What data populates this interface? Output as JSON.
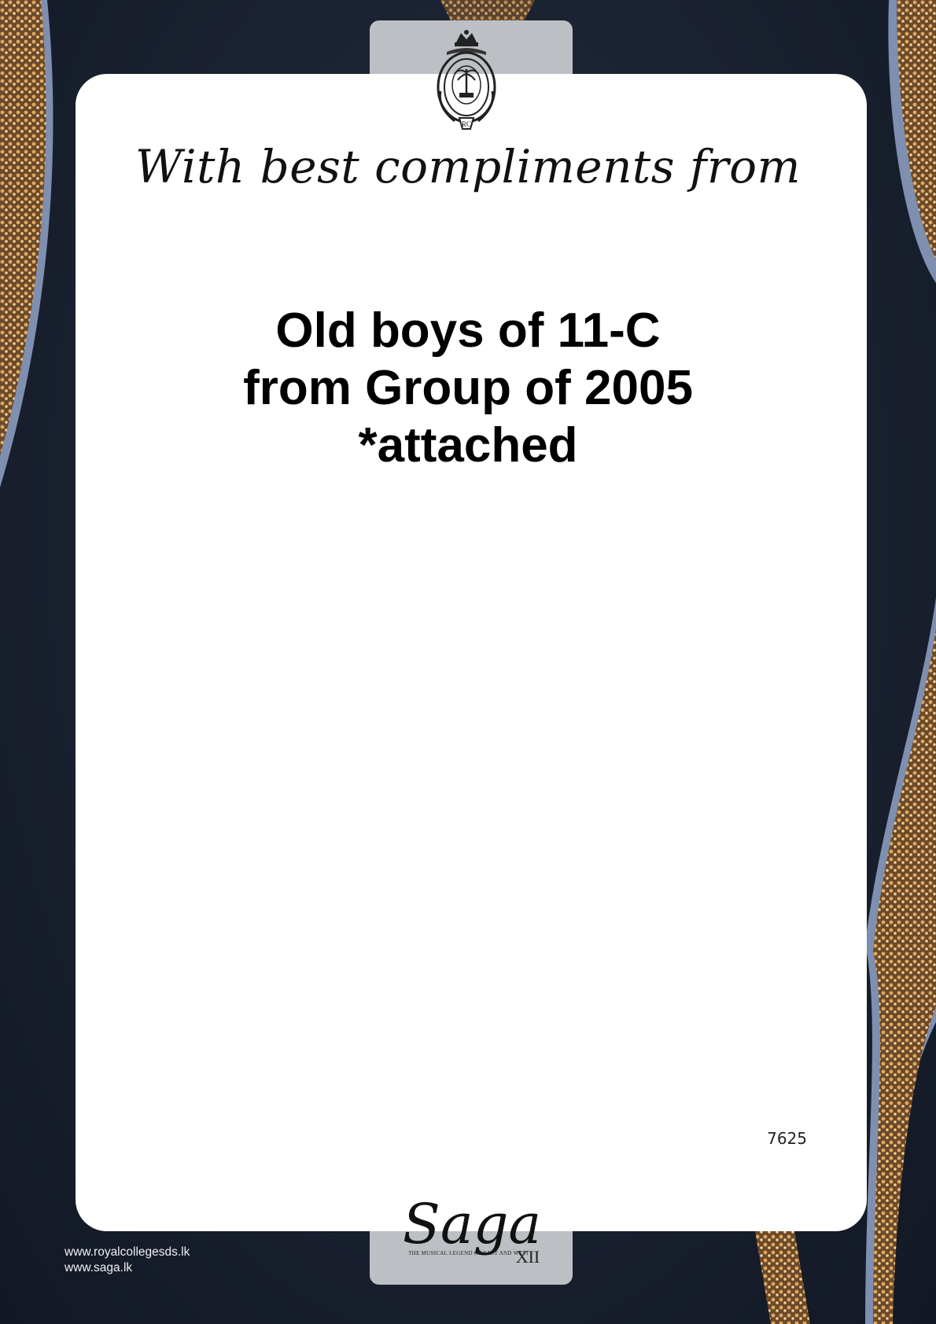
{
  "card": {
    "greeting": "With best compliments from",
    "donor_lines": [
      "Old boys of 11-C",
      "from Group of 2005",
      "*attached"
    ],
    "reference_number": "7625"
  },
  "crest": {
    "motto_top": "FLOREAT",
    "motto_ring": "DISCE AUT DISCEDE",
    "monogram": "RC"
  },
  "sponsor_logo": {
    "name": "Saga",
    "tagline": "THE MUSICAL LEGEND OF EAST AND WEST",
    "edition": "XII"
  },
  "footer": {
    "links": [
      "www.royalcollegesds.lk",
      "www.saga.lk"
    ]
  },
  "colors": {
    "background": "#1a2130",
    "card": "#ffffff",
    "tab": "#bcbfc4",
    "ribbon_gold": "#c8934a",
    "ribbon_edge": "#7e8fb0"
  }
}
